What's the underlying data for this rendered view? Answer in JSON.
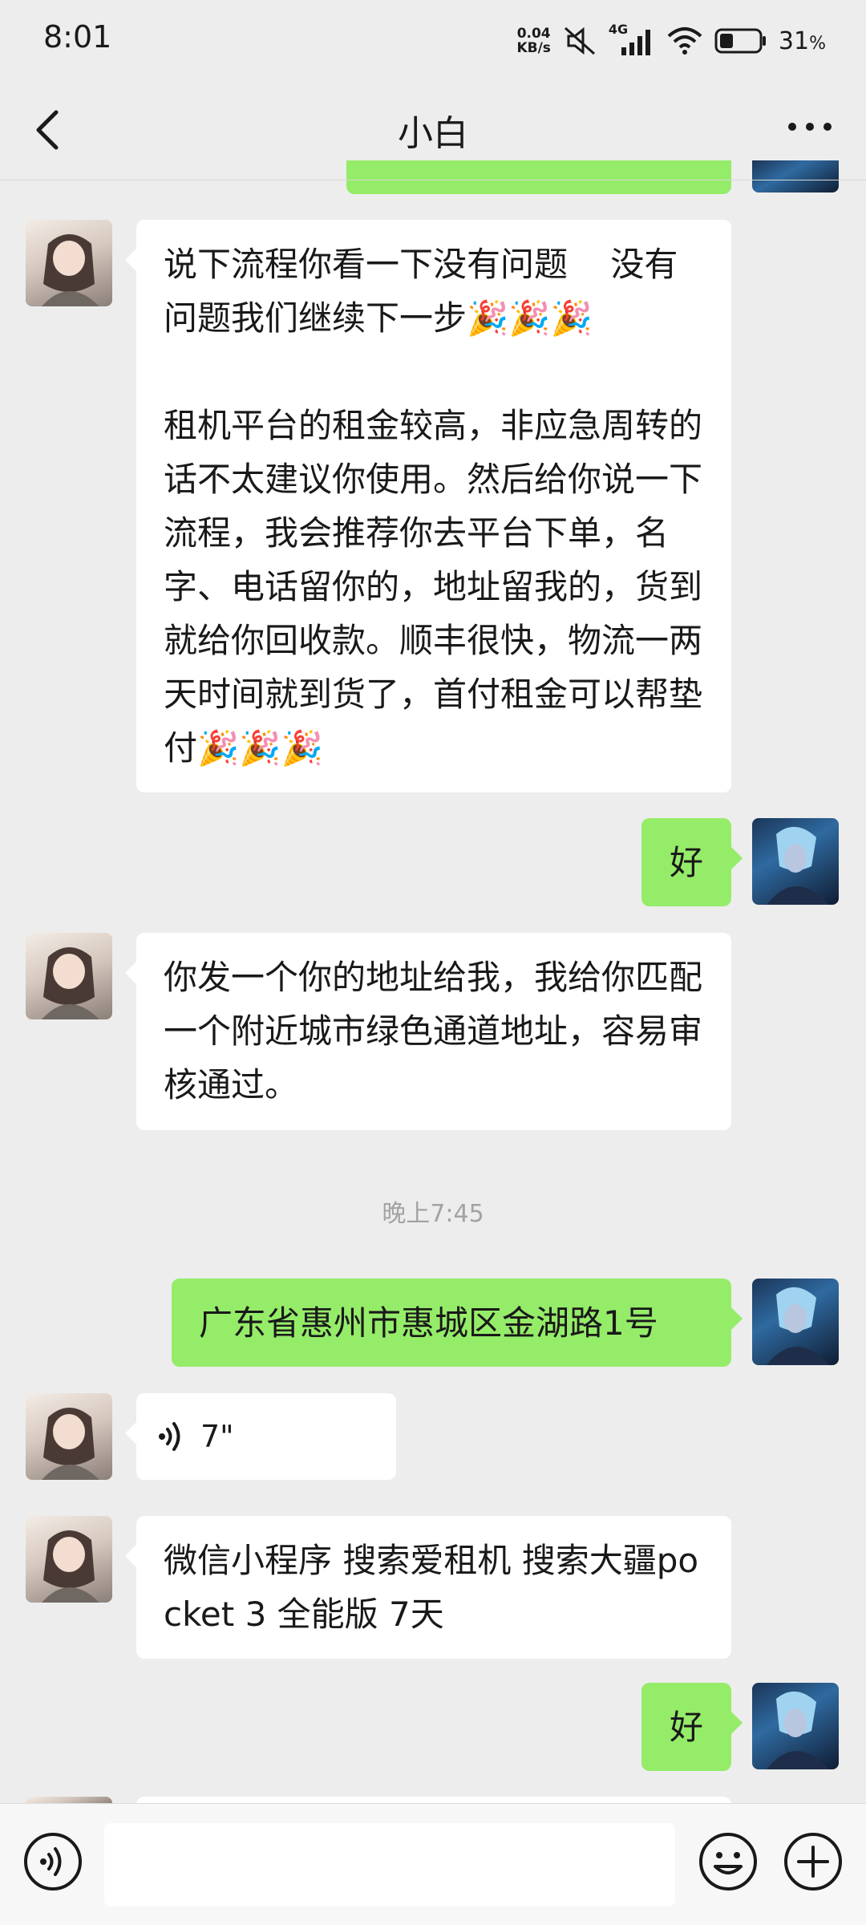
{
  "status_bar": {
    "time": "8:01",
    "net_speed_value": "0.04",
    "net_speed_unit": "KB/s",
    "network_type": "4G",
    "battery_percent": "31",
    "battery_suffix": "%"
  },
  "header": {
    "title": "小白"
  },
  "messages": [
    {
      "side": "in",
      "text": "说下流程你看一下没有问题    没有问题我们继续下一步",
      "emoji": "🎉🎉🎉",
      "text2": "租机平台的租金较高，非应急周转的话不太建议你使用。然后给你说一下流程，我会推荐你去平台下单，名字、电话留你的，地址留我的，货到就给你回收款。顺丰很快，物流一两天时间就到货了，首付租金可以帮垫付",
      "emoji2": "🎉🎉🎉"
    },
    {
      "side": "out",
      "text": "好"
    },
    {
      "side": "in",
      "text": "你发一个你的地址给我，我给你匹配一个附近城市绿色通道地址，容易审核通过。"
    },
    {
      "side": "out",
      "text": "广东省惠州市惠城区金湖路1号"
    },
    {
      "side": "in",
      "type": "voice",
      "duration": "7\""
    },
    {
      "side": "in",
      "text": "微信小程序 搜索爱租机 搜索大疆pocket 3 全能版 7天"
    },
    {
      "side": "out",
      "text": "好"
    }
  ],
  "time_separator": "晚上7:45",
  "input_bar": {
    "placeholder": ""
  },
  "colors": {
    "background": "#ededed",
    "outgoing_bubble": "#95ec69",
    "incoming_bubble": "#ffffff"
  }
}
